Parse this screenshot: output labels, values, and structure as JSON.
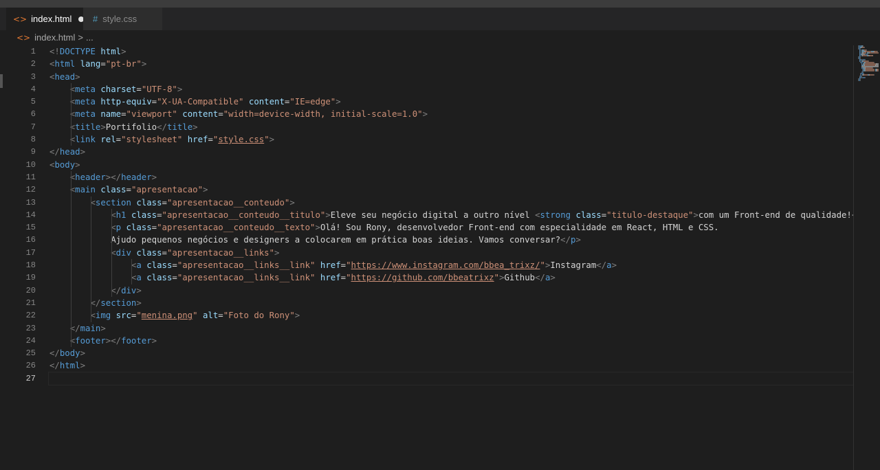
{
  "tabs": [
    {
      "label": "index.html",
      "icon": "html-file-icon",
      "active": true,
      "dirty": true
    },
    {
      "label": "style.css",
      "icon": "css-file-icon",
      "active": false,
      "dirty": false
    }
  ],
  "breadcrumb": {
    "file": "index.html",
    "separator": ">",
    "rest": "..."
  },
  "editor": {
    "current_line": 27,
    "line_numbers": [
      "1",
      "2",
      "3",
      "4",
      "5",
      "6",
      "7",
      "8",
      "9",
      "10",
      "11",
      "12",
      "13",
      "14",
      "15",
      "16",
      "17",
      "18",
      "19",
      "20",
      "21",
      "22",
      "23",
      "24",
      "25",
      "26",
      "27"
    ],
    "lines": [
      {
        "indent": 0,
        "tokens": [
          {
            "c": "p",
            "t": "<!"
          },
          {
            "c": "t",
            "t": "DOCTYPE"
          },
          {
            "c": "d",
            "t": " "
          },
          {
            "c": "a",
            "t": "html"
          },
          {
            "c": "p",
            "t": ">"
          }
        ]
      },
      {
        "indent": 0,
        "tokens": [
          {
            "c": "p",
            "t": "<"
          },
          {
            "c": "t",
            "t": "html"
          },
          {
            "c": "d",
            "t": " "
          },
          {
            "c": "a",
            "t": "lang"
          },
          {
            "c": "d",
            "t": "="
          },
          {
            "c": "s",
            "t": "\"pt-br\""
          },
          {
            "c": "p",
            "t": ">"
          }
        ]
      },
      {
        "indent": 0,
        "tokens": [
          {
            "c": "p",
            "t": "<"
          },
          {
            "c": "t",
            "t": "head"
          },
          {
            "c": "p",
            "t": ">"
          }
        ]
      },
      {
        "indent": 1,
        "tokens": [
          {
            "c": "p",
            "t": "<"
          },
          {
            "c": "t",
            "t": "meta"
          },
          {
            "c": "d",
            "t": " "
          },
          {
            "c": "a",
            "t": "charset"
          },
          {
            "c": "d",
            "t": "="
          },
          {
            "c": "s",
            "t": "\"UTF-8\""
          },
          {
            "c": "p",
            "t": ">"
          }
        ]
      },
      {
        "indent": 1,
        "tokens": [
          {
            "c": "p",
            "t": "<"
          },
          {
            "c": "t",
            "t": "meta"
          },
          {
            "c": "d",
            "t": " "
          },
          {
            "c": "a",
            "t": "http-equiv"
          },
          {
            "c": "d",
            "t": "="
          },
          {
            "c": "s",
            "t": "\"X-UA-Compatible\""
          },
          {
            "c": "d",
            "t": " "
          },
          {
            "c": "a",
            "t": "content"
          },
          {
            "c": "d",
            "t": "="
          },
          {
            "c": "s",
            "t": "\"IE=edge\""
          },
          {
            "c": "p",
            "t": ">"
          }
        ]
      },
      {
        "indent": 1,
        "tokens": [
          {
            "c": "p",
            "t": "<"
          },
          {
            "c": "t",
            "t": "meta"
          },
          {
            "c": "d",
            "t": " "
          },
          {
            "c": "a",
            "t": "name"
          },
          {
            "c": "d",
            "t": "="
          },
          {
            "c": "s",
            "t": "\"viewport\""
          },
          {
            "c": "d",
            "t": " "
          },
          {
            "c": "a",
            "t": "content"
          },
          {
            "c": "d",
            "t": "="
          },
          {
            "c": "s",
            "t": "\"width=device-width, initial-scale=1.0\""
          },
          {
            "c": "p",
            "t": ">"
          }
        ]
      },
      {
        "indent": 1,
        "tokens": [
          {
            "c": "p",
            "t": "<"
          },
          {
            "c": "t",
            "t": "title"
          },
          {
            "c": "p",
            "t": ">"
          },
          {
            "c": "d",
            "t": "Portifolio"
          },
          {
            "c": "p",
            "t": "</"
          },
          {
            "c": "t",
            "t": "title"
          },
          {
            "c": "p",
            "t": ">"
          }
        ]
      },
      {
        "indent": 1,
        "tokens": [
          {
            "c": "p",
            "t": "<"
          },
          {
            "c": "t",
            "t": "link"
          },
          {
            "c": "d",
            "t": " "
          },
          {
            "c": "a",
            "t": "rel"
          },
          {
            "c": "d",
            "t": "="
          },
          {
            "c": "s",
            "t": "\"stylesheet\""
          },
          {
            "c": "d",
            "t": " "
          },
          {
            "c": "a",
            "t": "href"
          },
          {
            "c": "d",
            "t": "="
          },
          {
            "c": "s",
            "t": "\""
          },
          {
            "c": "su",
            "t": "style.css"
          },
          {
            "c": "s",
            "t": "\""
          },
          {
            "c": "p",
            "t": ">"
          }
        ]
      },
      {
        "indent": 0,
        "tokens": [
          {
            "c": "p",
            "t": "</"
          },
          {
            "c": "t",
            "t": "head"
          },
          {
            "c": "p",
            "t": ">"
          }
        ]
      },
      {
        "indent": 0,
        "tokens": [
          {
            "c": "p",
            "t": "<"
          },
          {
            "c": "t",
            "t": "body"
          },
          {
            "c": "p",
            "t": ">"
          }
        ]
      },
      {
        "indent": 1,
        "tokens": [
          {
            "c": "p",
            "t": "<"
          },
          {
            "c": "t",
            "t": "header"
          },
          {
            "c": "p",
            "t": "></"
          },
          {
            "c": "t",
            "t": "header"
          },
          {
            "c": "p",
            "t": ">"
          }
        ]
      },
      {
        "indent": 1,
        "tokens": [
          {
            "c": "p",
            "t": "<"
          },
          {
            "c": "t",
            "t": "main"
          },
          {
            "c": "d",
            "t": " "
          },
          {
            "c": "a",
            "t": "class"
          },
          {
            "c": "d",
            "t": "="
          },
          {
            "c": "s",
            "t": "\"apresentacao\""
          },
          {
            "c": "p",
            "t": ">"
          }
        ]
      },
      {
        "indent": 2,
        "tokens": [
          {
            "c": "p",
            "t": "<"
          },
          {
            "c": "t",
            "t": "section"
          },
          {
            "c": "d",
            "t": " "
          },
          {
            "c": "a",
            "t": "class"
          },
          {
            "c": "d",
            "t": "="
          },
          {
            "c": "s",
            "t": "\"apresentacao__conteudo\""
          },
          {
            "c": "p",
            "t": ">"
          }
        ]
      },
      {
        "indent": 3,
        "tokens": [
          {
            "c": "p",
            "t": "<"
          },
          {
            "c": "t",
            "t": "h1"
          },
          {
            "c": "d",
            "t": " "
          },
          {
            "c": "a",
            "t": "class"
          },
          {
            "c": "d",
            "t": "="
          },
          {
            "c": "s",
            "t": "\"apresentacao__conteudo__titulo\""
          },
          {
            "c": "p",
            "t": ">"
          },
          {
            "c": "d",
            "t": "Eleve seu negócio digital a outro nível "
          },
          {
            "c": "p",
            "t": "<"
          },
          {
            "c": "t",
            "t": "strong"
          },
          {
            "c": "d",
            "t": " "
          },
          {
            "c": "a",
            "t": "class"
          },
          {
            "c": "d",
            "t": "="
          },
          {
            "c": "s",
            "t": "\"titulo-destaque\""
          },
          {
            "c": "p",
            "t": ">"
          },
          {
            "c": "d",
            "t": "com um Front-end de qualidade!"
          },
          {
            "c": "p",
            "t": "<"
          }
        ]
      },
      {
        "indent": 3,
        "tokens": [
          {
            "c": "p",
            "t": "<"
          },
          {
            "c": "t",
            "t": "p"
          },
          {
            "c": "d",
            "t": " "
          },
          {
            "c": "a",
            "t": "class"
          },
          {
            "c": "d",
            "t": "="
          },
          {
            "c": "s",
            "t": "\"apresentacao__conteudo__texto\""
          },
          {
            "c": "p",
            "t": ">"
          },
          {
            "c": "d",
            "t": "Olá! Sou Rony, desenvolvedor Front-end com especialidade em React, HTML e CSS."
          }
        ]
      },
      {
        "indent": 3,
        "tokens": [
          {
            "c": "d",
            "t": "Ajudo pequenos negócios e designers a colocarem em prática boas ideias. Vamos conversar?"
          },
          {
            "c": "p",
            "t": "</"
          },
          {
            "c": "t",
            "t": "p"
          },
          {
            "c": "p",
            "t": ">"
          }
        ]
      },
      {
        "indent": 3,
        "tokens": [
          {
            "c": "p",
            "t": "<"
          },
          {
            "c": "t",
            "t": "div"
          },
          {
            "c": "d",
            "t": " "
          },
          {
            "c": "a",
            "t": "class"
          },
          {
            "c": "d",
            "t": "="
          },
          {
            "c": "s",
            "t": "\"apresentacao__links\""
          },
          {
            "c": "p",
            "t": ">"
          }
        ]
      },
      {
        "indent": 4,
        "tokens": [
          {
            "c": "p",
            "t": "<"
          },
          {
            "c": "t",
            "t": "a"
          },
          {
            "c": "d",
            "t": " "
          },
          {
            "c": "a",
            "t": "class"
          },
          {
            "c": "d",
            "t": "="
          },
          {
            "c": "s",
            "t": "\"apresentacao__links__link\""
          },
          {
            "c": "d",
            "t": " "
          },
          {
            "c": "a",
            "t": "href"
          },
          {
            "c": "d",
            "t": "="
          },
          {
            "c": "s",
            "t": "\""
          },
          {
            "c": "su",
            "t": "https://www.instagram.com/bbea_trixz/"
          },
          {
            "c": "s",
            "t": "\""
          },
          {
            "c": "p",
            "t": ">"
          },
          {
            "c": "d",
            "t": "Instagram"
          },
          {
            "c": "p",
            "t": "</"
          },
          {
            "c": "t",
            "t": "a"
          },
          {
            "c": "p",
            "t": ">"
          }
        ]
      },
      {
        "indent": 4,
        "tokens": [
          {
            "c": "p",
            "t": "<"
          },
          {
            "c": "t",
            "t": "a"
          },
          {
            "c": "d",
            "t": " "
          },
          {
            "c": "a",
            "t": "class"
          },
          {
            "c": "d",
            "t": "="
          },
          {
            "c": "s",
            "t": "\"apresentacao__links__link\""
          },
          {
            "c": "d",
            "t": " "
          },
          {
            "c": "a",
            "t": "href"
          },
          {
            "c": "d",
            "t": "="
          },
          {
            "c": "s",
            "t": "\""
          },
          {
            "c": "su",
            "t": "https://github.com/bbeatrixz"
          },
          {
            "c": "s",
            "t": "\""
          },
          {
            "c": "p",
            "t": ">"
          },
          {
            "c": "d",
            "t": "Github"
          },
          {
            "c": "p",
            "t": "</"
          },
          {
            "c": "t",
            "t": "a"
          },
          {
            "c": "p",
            "t": ">"
          }
        ]
      },
      {
        "indent": 3,
        "tokens": [
          {
            "c": "p",
            "t": "</"
          },
          {
            "c": "t",
            "t": "div"
          },
          {
            "c": "p",
            "t": ">"
          }
        ]
      },
      {
        "indent": 2,
        "tokens": [
          {
            "c": "p",
            "t": "</"
          },
          {
            "c": "t",
            "t": "section"
          },
          {
            "c": "p",
            "t": ">"
          }
        ]
      },
      {
        "indent": 2,
        "tokens": [
          {
            "c": "p",
            "t": "<"
          },
          {
            "c": "t",
            "t": "img"
          },
          {
            "c": "d",
            "t": " "
          },
          {
            "c": "a",
            "t": "src"
          },
          {
            "c": "d",
            "t": "="
          },
          {
            "c": "s",
            "t": "\""
          },
          {
            "c": "su",
            "t": "menina.png"
          },
          {
            "c": "s",
            "t": "\""
          },
          {
            "c": "d",
            "t": " "
          },
          {
            "c": "a",
            "t": "alt"
          },
          {
            "c": "d",
            "t": "="
          },
          {
            "c": "s",
            "t": "\"Foto do Rony\""
          },
          {
            "c": "p",
            "t": ">"
          }
        ]
      },
      {
        "indent": 1,
        "tokens": [
          {
            "c": "p",
            "t": "</"
          },
          {
            "c": "t",
            "t": "main"
          },
          {
            "c": "p",
            "t": ">"
          }
        ]
      },
      {
        "indent": 1,
        "tokens": [
          {
            "c": "p",
            "t": "<"
          },
          {
            "c": "t",
            "t": "footer"
          },
          {
            "c": "p",
            "t": "></"
          },
          {
            "c": "t",
            "t": "footer"
          },
          {
            "c": "p",
            "t": ">"
          }
        ]
      },
      {
        "indent": 0,
        "tokens": [
          {
            "c": "p",
            "t": "</"
          },
          {
            "c": "t",
            "t": "body"
          },
          {
            "c": "p",
            "t": ">"
          }
        ]
      },
      {
        "indent": 0,
        "tokens": [
          {
            "c": "p",
            "t": "</"
          },
          {
            "c": "t",
            "t": "html"
          },
          {
            "c": "p",
            "t": ">"
          }
        ]
      },
      {
        "indent": 0,
        "tokens": []
      }
    ]
  },
  "colors": {
    "background": "#1e1e1e",
    "tag": "#569cd6",
    "punctuation": "#808080",
    "attribute": "#9cdcfe",
    "string": "#ce9178",
    "text": "#d4d4d4",
    "html_icon": "#e37933",
    "css_icon": "#519aba"
  }
}
